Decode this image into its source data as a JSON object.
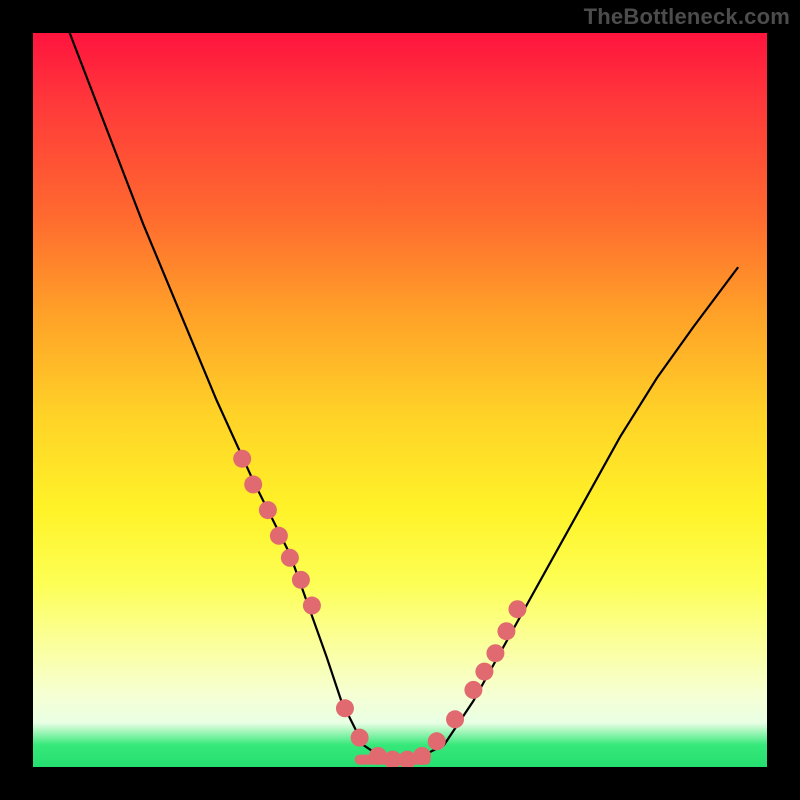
{
  "watermark": "TheBottleneck.com",
  "colors": {
    "frame": "#000000",
    "watermark_text": "#4c4c4c",
    "dot": "#e06a6f",
    "curve": "#000000",
    "gradient_stops": [
      "#ff143e",
      "#ff3a3a",
      "#ff6a2f",
      "#ffa028",
      "#ffd227",
      "#fff328",
      "#fdff55",
      "#fbff9a",
      "#f6ffd2",
      "#e9ffe4",
      "#36e87a",
      "#24df6f"
    ]
  },
  "chart_data": {
    "type": "line",
    "title": "",
    "xlabel": "",
    "ylabel": "",
    "xlim": [
      0,
      100
    ],
    "ylim": [
      0,
      100
    ],
    "grid": false,
    "legend": false,
    "note": "Axes are unlabeled; values below are proportional positions (0–100) read from the plot area, origin at bottom-left.",
    "series": [
      {
        "name": "curve",
        "x": [
          5,
          10,
          15,
          20,
          25,
          30,
          35,
          40,
          42,
          45,
          48,
          50,
          52,
          56,
          60,
          65,
          70,
          75,
          80,
          85,
          90,
          96
        ],
        "y": [
          100,
          87,
          74,
          62,
          50,
          39,
          29,
          15,
          9,
          3,
          1,
          1,
          1,
          3,
          9,
          18,
          27,
          36,
          45,
          53,
          60,
          68
        ]
      }
    ],
    "markers": {
      "name": "highlighted-points",
      "x": [
        28.5,
        30.0,
        32.0,
        33.5,
        35.0,
        36.5,
        38.0,
        42.5,
        44.5,
        47.0,
        49.0,
        51.0,
        53.0,
        55.0,
        57.5,
        60.0,
        61.5,
        63.0,
        64.5,
        66.0
      ],
      "y": [
        42.0,
        38.5,
        35.0,
        31.5,
        28.5,
        25.5,
        22.0,
        8.0,
        4.0,
        1.5,
        1.0,
        1.0,
        1.5,
        3.5,
        6.5,
        10.5,
        13.0,
        15.5,
        18.5,
        21.5
      ]
    },
    "flat_segment": {
      "x": [
        44.5,
        53.5
      ],
      "y": 1.0
    }
  }
}
